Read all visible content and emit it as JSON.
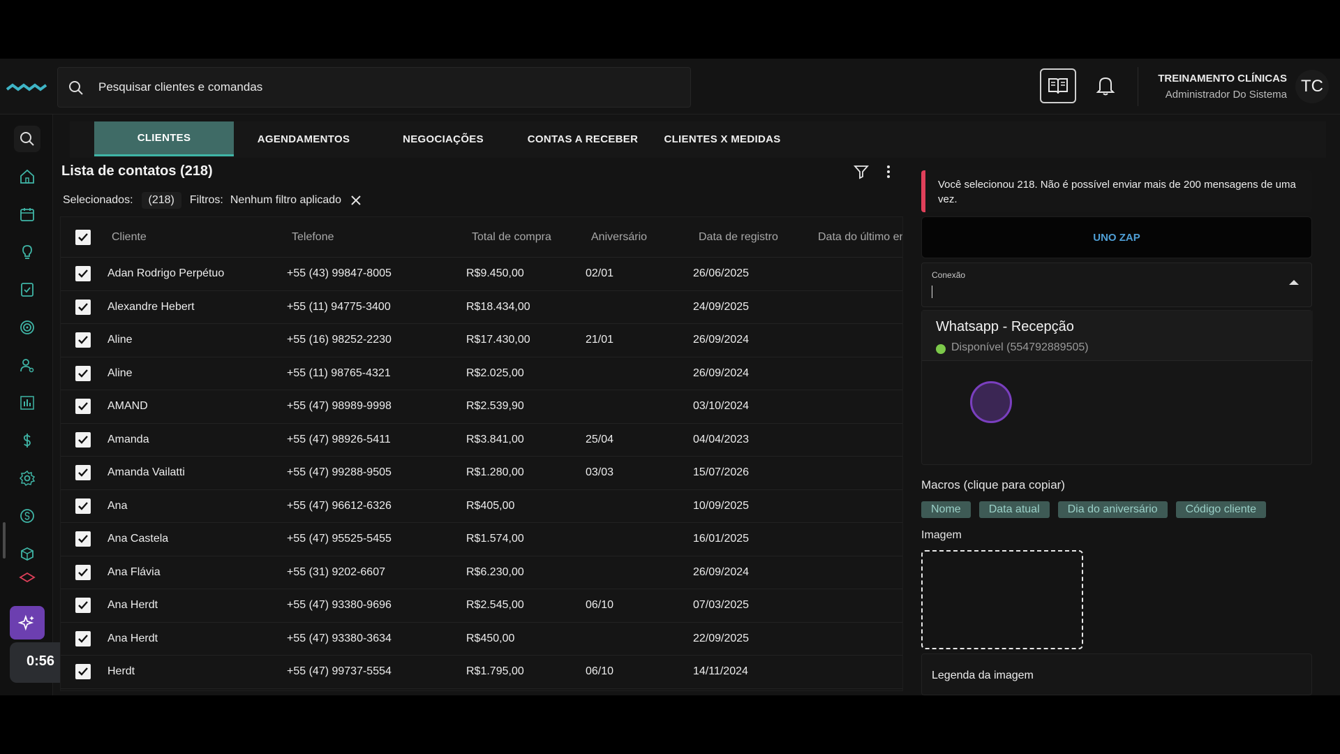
{
  "header": {
    "search_placeholder": "Pesquisar clientes e comandas",
    "user_name": "TREINAMENTO CLÍNICAS",
    "user_role": "Administrador Do Sistema",
    "avatar_initials": "TC"
  },
  "sidebar": {
    "items": [
      "search-icon",
      "home-icon",
      "calendar-icon",
      "lightbulb-icon",
      "clipboard-check-icon",
      "target-icon",
      "user-icon",
      "bar-chart-icon",
      "dollar-icon",
      "gear-icon",
      "coin-icon",
      "box-icon",
      "layers-icon"
    ],
    "ai_icon": "sparkles-icon"
  },
  "recorder": {
    "time": "0:56"
  },
  "tabs": [
    {
      "label": "CLIENTES",
      "active": true
    },
    {
      "label": "AGENDAMENTOS",
      "active": false
    },
    {
      "label": "NEGOCIAÇÕES",
      "active": false
    },
    {
      "label": "CONTAS A RECEBER",
      "active": false
    },
    {
      "label": "CLIENTES X MEDIDAS",
      "active": false
    }
  ],
  "list": {
    "title": "Lista de contatos (218)",
    "selected_label": "Selecionados:",
    "selected_count": "(218)",
    "filters_label": "Filtros:",
    "filters_value": "Nenhum filtro aplicado"
  },
  "table": {
    "columns": [
      "Cliente",
      "Telefone",
      "Total de compra",
      "Aniversário",
      "Data de registro",
      "Data do último en"
    ],
    "rows": [
      {
        "cliente": "Adan Rodrigo Perpétuo",
        "telefone": "+55 (43) 99847-8005",
        "total": "R$9.450,00",
        "aniversario": "02/01",
        "registro": "26/06/2025"
      },
      {
        "cliente": "Alexandre Hebert",
        "telefone": "+55 (11) 94775-3400",
        "total": "R$18.434,00",
        "aniversario": "",
        "registro": "24/09/2025"
      },
      {
        "cliente": "Aline",
        "telefone": "+55 (16) 98252-2230",
        "total": "R$17.430,00",
        "aniversario": "21/01",
        "registro": "26/09/2024"
      },
      {
        "cliente": "Aline",
        "telefone": "+55 (11) 98765-4321",
        "total": "R$2.025,00",
        "aniversario": "",
        "registro": "26/09/2024"
      },
      {
        "cliente": "AMAND",
        "telefone": "+55 (47) 98989-9998",
        "total": "R$2.539,90",
        "aniversario": "",
        "registro": "03/10/2024"
      },
      {
        "cliente": "Amanda",
        "telefone": "+55 (47) 98926-5411",
        "total": "R$3.841,00",
        "aniversario": "25/04",
        "registro": "04/04/2023"
      },
      {
        "cliente": "Amanda Vailatti",
        "telefone": "+55 (47) 99288-9505",
        "total": "R$1.280,00",
        "aniversario": "03/03",
        "registro": "15/07/2026"
      },
      {
        "cliente": "Ana",
        "telefone": "+55 (47) 96612-6326",
        "total": "R$405,00",
        "aniversario": "",
        "registro": "10/09/2025"
      },
      {
        "cliente": "Ana Castela",
        "telefone": "+55 (47) 95525-5455",
        "total": "R$1.574,00",
        "aniversario": "",
        "registro": "16/01/2025"
      },
      {
        "cliente": "Ana Flávia",
        "telefone": "+55 (31) 9202-6607",
        "total": "R$6.230,00",
        "aniversario": "",
        "registro": "26/09/2024"
      },
      {
        "cliente": "Ana Herdt",
        "telefone": "+55 (47) 93380-9696",
        "total": "R$2.545,00",
        "aniversario": "06/10",
        "registro": "07/03/2025"
      },
      {
        "cliente": "Ana Herdt",
        "telefone": "+55 (47) 93380-3634",
        "total": "R$450,00",
        "aniversario": "",
        "registro": "22/09/2025"
      },
      {
        "cliente": "Herdt",
        "telefone": "+55 (47) 99737-5554",
        "total": "R$1.795,00",
        "aniversario": "06/10",
        "registro": "14/11/2024"
      }
    ]
  },
  "panel": {
    "alert_text": "Você selecionou 218. Não é possível enviar mais de 200 mensagens de uma vez.",
    "uno_zap": "UNO ZAP",
    "connection_label": "Conexão",
    "option_title": "Whatsapp - Recepção",
    "option_status": "Disponível (554792889505)",
    "macros_title": "Macros (clique para copiar)",
    "macros": [
      "Nome",
      "Data atual",
      "Dia do aniversário",
      "Código cliente"
    ],
    "image_title": "Imagem",
    "legend_placeholder": "Legenda da imagem"
  },
  "colors": {
    "accent_tab": "#3f6b66",
    "alert_bar": "#e0405a",
    "uno_zap": "#4f9fd6",
    "status_dot": "#7cc94a",
    "ai_button": "#6c3fb0"
  }
}
